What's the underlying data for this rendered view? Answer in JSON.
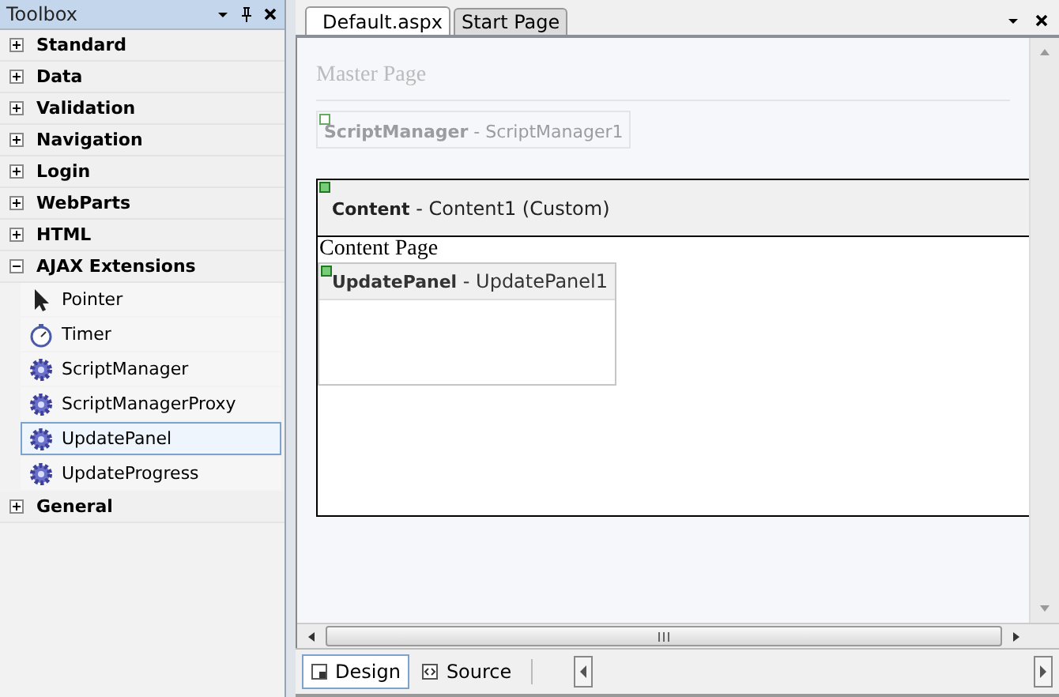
{
  "toolbox": {
    "title": "Toolbox",
    "categories": [
      {
        "label": "Standard",
        "expanded": false
      },
      {
        "label": "Data",
        "expanded": false
      },
      {
        "label": "Validation",
        "expanded": false
      },
      {
        "label": "Navigation",
        "expanded": false
      },
      {
        "label": "Login",
        "expanded": false
      },
      {
        "label": "WebParts",
        "expanded": false
      },
      {
        "label": "HTML",
        "expanded": false
      },
      {
        "label": "AJAX Extensions",
        "expanded": true,
        "children": [
          {
            "label": "Pointer",
            "kind": "pointer",
            "selected": false
          },
          {
            "label": "Timer",
            "kind": "timer",
            "selected": false
          },
          {
            "label": "ScriptManager",
            "kind": "gear",
            "selected": false
          },
          {
            "label": "ScriptManagerProxy",
            "kind": "gear",
            "selected": false
          },
          {
            "label": "UpdatePanel",
            "kind": "gear",
            "selected": true
          },
          {
            "label": "UpdateProgress",
            "kind": "gear",
            "selected": false
          }
        ]
      },
      {
        "label": "General",
        "expanded": false
      }
    ]
  },
  "tabs": [
    {
      "label": "Default.aspx",
      "selected": true
    },
    {
      "label": "Start Page",
      "selected": false
    }
  ],
  "designer": {
    "master_title": "Master Page",
    "script_manager": {
      "type": "ScriptManager",
      "id": "- ScriptManager1"
    },
    "content": {
      "type": "Content",
      "id": "- Content1 (Custom)",
      "text": "Content Page",
      "update_panel": {
        "type": "UpdatePanel",
        "id": "- UpdatePanel1"
      }
    }
  },
  "view_buttons": [
    {
      "label": "Design",
      "kind": "design",
      "selected": true
    },
    {
      "label": "Source",
      "kind": "source",
      "selected": false
    }
  ]
}
